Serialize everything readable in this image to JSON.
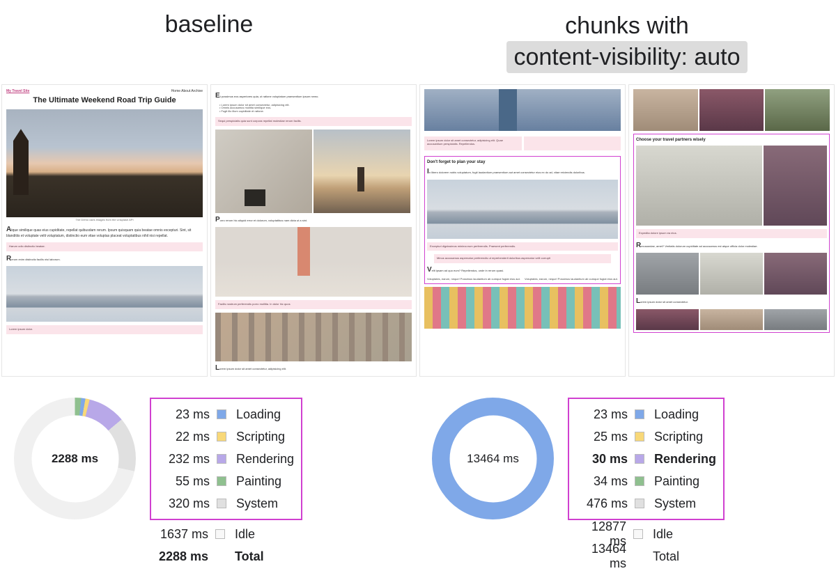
{
  "headings": {
    "left": "baseline",
    "right_line1": "chunks with",
    "right_code": "content-visibility: auto"
  },
  "mock_left_a": {
    "brand": "My Travel Site",
    "nav": "Home  About  Archive",
    "title": "The Ultimate Weekend Road Trip Guide",
    "caption": "The Demo uses images from the Unsplash API",
    "para1": "Atque similique quas eius cupiditate, repellat quibusdam rerum. Ipsum quisquam quia beatae omnis excepturi. Sint, sit blanditiis et voluptate velit voluptatum, distinctio eum vitae voluptas placeat voluptatibus nihil nisi repellat.",
    "pink1": "Harum odio distinctio beatae.",
    "para2": "Rerum enim distinctio facilis nisi laborum.",
    "pink2": "Lorem ipsum dolor."
  },
  "mock_left_b": {
    "list_intro": "Et possimus eos asperiores quia, ut ratione voluptatum praesentium ipsum nemo.",
    "bullets": "• Lorem ipsum dolor sit amet consectetur, adipisicing elit.\n• Omnis accusamus mollitia similique eos.\n• Fugit illo illum cupiditate et ratione.",
    "pink1": "Sequi perspiciatis quia sunt corpora repellat molestiae rerum facilis.",
    "para1": "Porro rerum hic aliquid error et dolorum, voluptatibus nam dicta ut a sint.",
    "pink2": "Facilis nostrum perferendis porro mollitia. In dolor hic quos",
    "para2": "Lorem ipsum dolor sit amet consectetur, adipisicing elit."
  },
  "mock_right_a": {
    "pink_top": "Lorem ipsum dolor sit amet consectetur, adipisicing elit. Quae accusantium perspiciatis. Repellendus.",
    "sec_title": "Don't forget to plan your stay",
    "sec_para": "In libero dolorem nobis voluptatum, fugit laudantium praesentium aut amet consectetur eius ex do ad, vitae reiciendis doloribus.",
    "pink1": "Excepturi dignissimos minima eum perferendis. Praesent perferendis.",
    "pink2": "Minus accusamus aspernatur perferendis ut reprehenderit doloribus aspernatur velit corrupti",
    "para1": "Velit ipsam ad quo eum? Repellendus, unde in rerum quasi.",
    "para2": "Voluptates, earum, neque! Possimus laudantium ab cumque fugiat eius aut."
  },
  "mock_right_b": {
    "sec_title": "Choose your travel partners wisely",
    "para1": "Recusandae, amet? Veritatis dolorum cupiditate ad accusamus est atque officia dolor molestiae.",
    "pink1": "Expedita dolore ipsum ea eius.",
    "para2": "Lorem ipsum dolor sit amet consectetur."
  },
  "perf_left": {
    "donut_total": "2288 ms",
    "categories": [
      {
        "value": "23 ms",
        "label": "Loading",
        "color": "c-loading",
        "bold": false
      },
      {
        "value": "22 ms",
        "label": "Scripting",
        "color": "c-scripting",
        "bold": false
      },
      {
        "value": "232 ms",
        "label": "Rendering",
        "color": "c-rendering",
        "bold": false
      },
      {
        "value": "55 ms",
        "label": "Painting",
        "color": "c-painting",
        "bold": false
      },
      {
        "value": "320 ms",
        "label": "System",
        "color": "c-system",
        "bold": false
      }
    ],
    "idle": "1637 ms",
    "idle_label": "Idle",
    "total": "2288 ms",
    "total_label": "Total"
  },
  "perf_right": {
    "donut_total": "13464 ms",
    "categories": [
      {
        "value": "23 ms",
        "label": "Loading",
        "color": "c-loading",
        "bold": false
      },
      {
        "value": "25 ms",
        "label": "Scripting",
        "color": "c-scripting",
        "bold": false
      },
      {
        "value": "30 ms",
        "label": "Rendering",
        "color": "c-rendering",
        "bold": true
      },
      {
        "value": "34 ms",
        "label": "Painting",
        "color": "c-painting",
        "bold": false
      },
      {
        "value": "476 ms",
        "label": "System",
        "color": "c-system",
        "bold": false
      }
    ],
    "idle": "12877 ms",
    "idle_label": "Idle",
    "total": "13464 ms",
    "total_label": "Total"
  },
  "chart_data": [
    {
      "type": "pie",
      "title": "baseline",
      "total_ms": 2288,
      "series": [
        {
          "name": "Loading",
          "value": 23
        },
        {
          "name": "Scripting",
          "value": 22
        },
        {
          "name": "Rendering",
          "value": 232
        },
        {
          "name": "Painting",
          "value": 55
        },
        {
          "name": "System",
          "value": 320
        },
        {
          "name": "Idle",
          "value": 1637
        }
      ]
    },
    {
      "type": "pie",
      "title": "chunks with content-visibility: auto",
      "total_ms": 13464,
      "series": [
        {
          "name": "Loading",
          "value": 23
        },
        {
          "name": "Scripting",
          "value": 25
        },
        {
          "name": "Rendering",
          "value": 30
        },
        {
          "name": "Painting",
          "value": 34
        },
        {
          "name": "System",
          "value": 476
        },
        {
          "name": "Idle",
          "value": 12877
        }
      ]
    }
  ]
}
